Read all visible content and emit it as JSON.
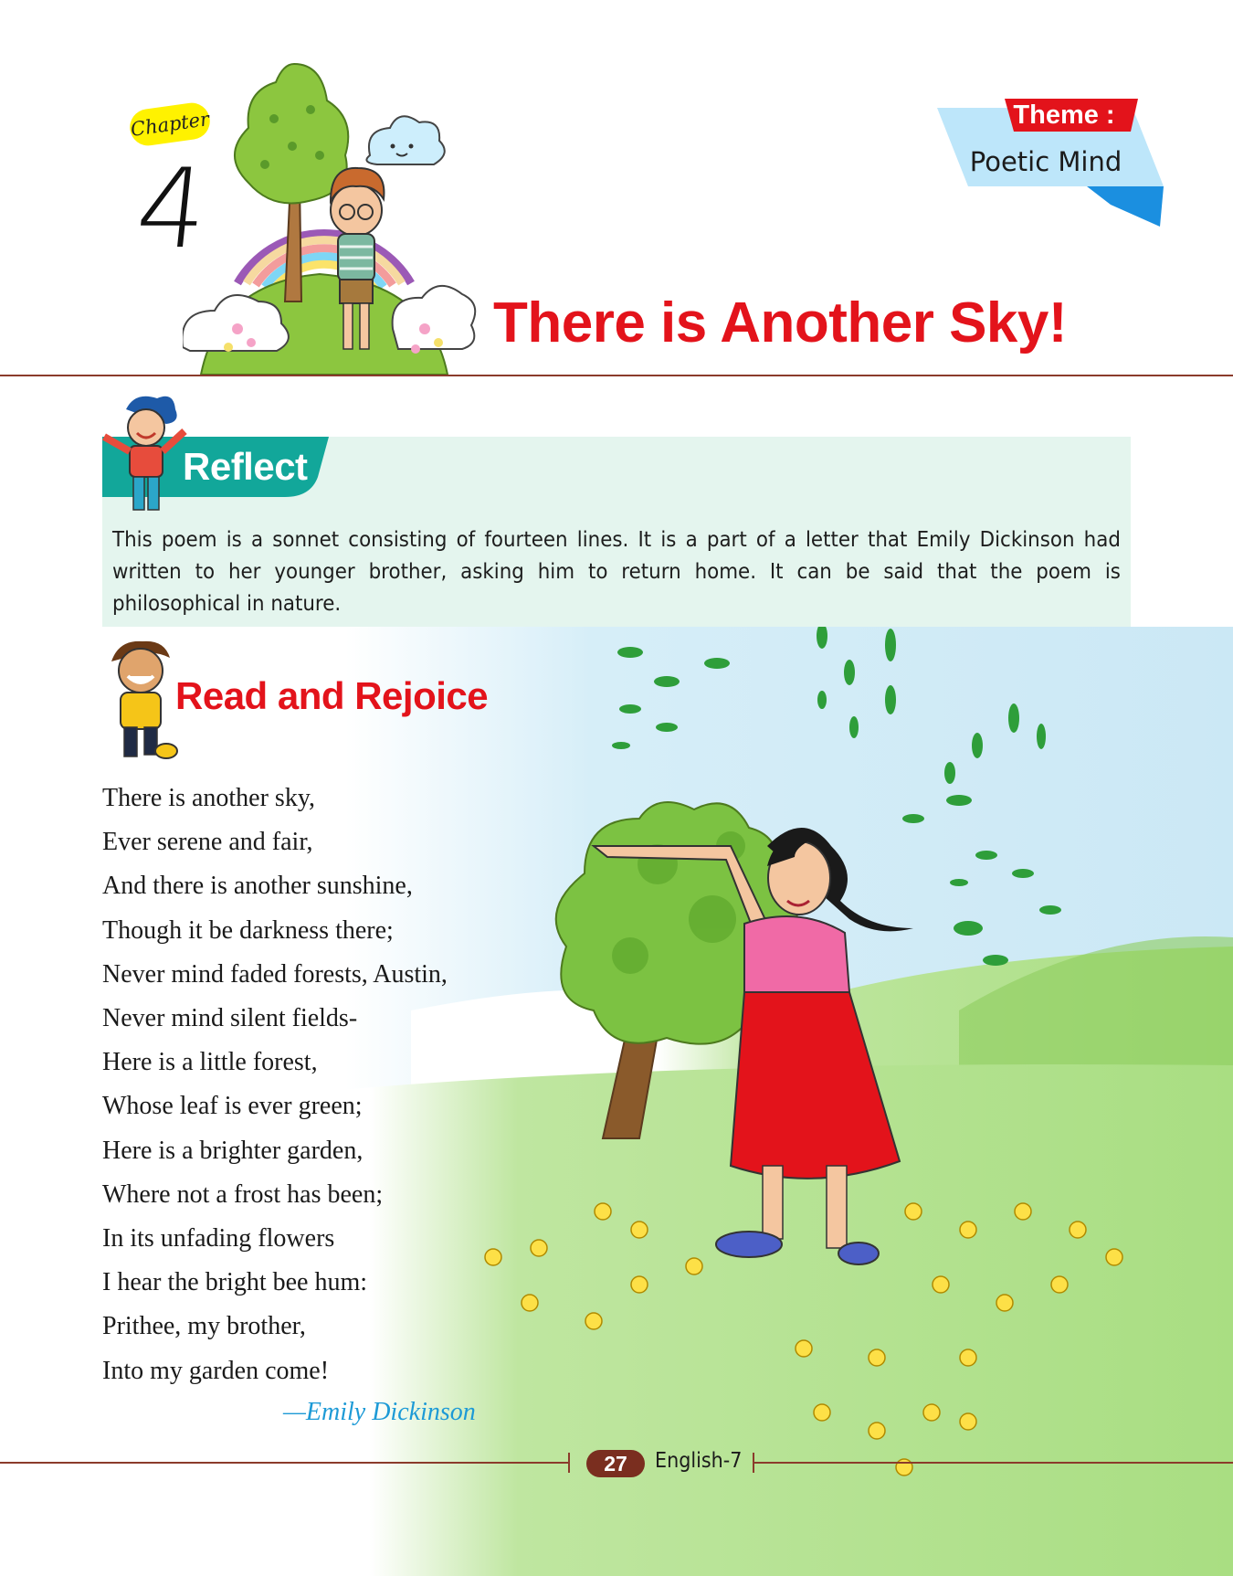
{
  "header": {
    "chapter_label": "Chapter",
    "chapter_number": "4",
    "theme_label": "Theme :",
    "theme_value": "Poetic Mind",
    "title": "There is Another Sky!"
  },
  "reflect": {
    "heading": "Reflect",
    "text": "This poem is a sonnet consisting of fourteen lines. It is a part of a letter that Emily Dickinson had written to her younger brother, asking him to return home. It can be said that the poem is philosophical in nature."
  },
  "read": {
    "heading": "Read and Rejoice",
    "poem_lines": [
      "There is another sky,",
      "Ever serene and fair,",
      "And there is another sunshine,",
      "Though it be darkness there;",
      "Never mind faded forests, Austin,",
      "Never mind silent fields-",
      "Here is a little forest,",
      "Whose leaf is ever green;",
      "Here is a brighter garden,",
      "Where not a frost has been;",
      "In its unfading flowers",
      "I hear the bright bee hum:",
      "Prithee, my brother,",
      "Into my garden come!"
    ],
    "author": "—Emily Dickinson"
  },
  "footer": {
    "page_number": "27",
    "book": "English-7"
  },
  "colors": {
    "title_red": "#e3131b",
    "reflect_teal": "#12a79a",
    "reflect_bg": "#e4f5ee",
    "author_blue": "#1d9ad6",
    "rule_brown": "#8b3b2b",
    "sky": "#cfe9f6",
    "grass": "#a6dd7d"
  }
}
